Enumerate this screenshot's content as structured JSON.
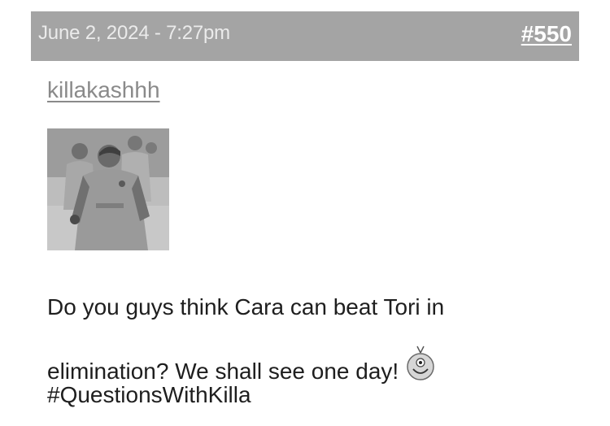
{
  "post": {
    "date": "June 2, 2024 - 7:27pm",
    "number": "#550",
    "username": "killakashhh",
    "avatar_icon": "avatar-photo",
    "body": {
      "line1": "Do you guys think Cara can beat Tori in",
      "line2": "elimination? We shall see one day!",
      "line3": "#QuestionsWithKilla",
      "emoji_icon": "smiley-icon"
    }
  },
  "colors": {
    "header_bg": "#a4a4a4",
    "header_text": "#ebebeb",
    "username": "#8a8a8a",
    "body_text": "#1e1e1e"
  }
}
